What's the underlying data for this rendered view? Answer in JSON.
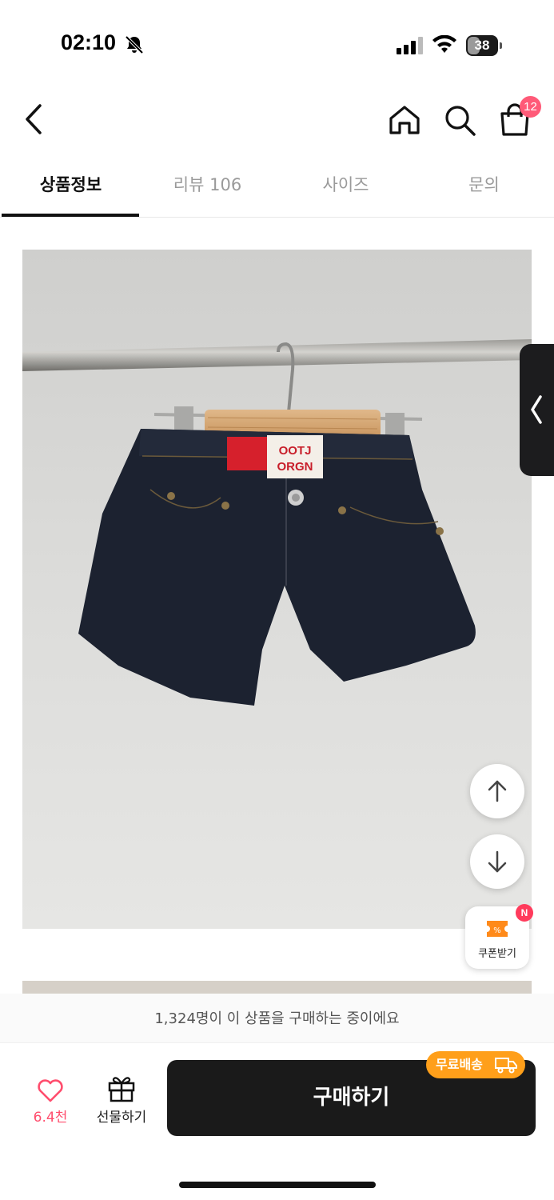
{
  "status_bar": {
    "time": "02:10",
    "battery_level": "38"
  },
  "header": {
    "cart_count": "12"
  },
  "tabs": [
    {
      "label": "상품정보",
      "active": true
    },
    {
      "label": "리뷰 106",
      "active": false
    },
    {
      "label": "사이즈",
      "active": false
    },
    {
      "label": "문의",
      "active": false
    }
  ],
  "product_image": {
    "tag_text_line1": "OOTJ",
    "tag_text_line2": "ORGN"
  },
  "floating": {
    "coupon_label": "쿠폰받기",
    "coupon_badge": "N"
  },
  "bottom": {
    "buyers_text": "1,324명이 이 상품을 구매하는 중이에요",
    "like_count": "6.4천",
    "gift_label": "선물하기",
    "buy_label": "구매하기",
    "free_shipping_label": "무료배송"
  },
  "colors": {
    "accent_pink": "#ff4d6d",
    "buy_button": "#1a1a1a",
    "free_shipping": "#ff9f1a"
  }
}
